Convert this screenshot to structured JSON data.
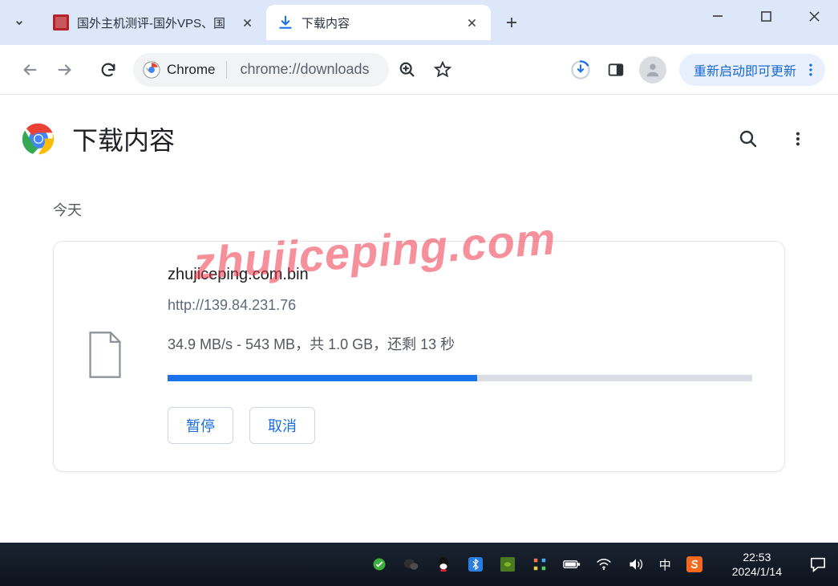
{
  "tabs": [
    {
      "title": "国外主机测评-国外VPS、国"
    },
    {
      "title": "下载内容"
    }
  ],
  "address": {
    "chip": "Chrome",
    "url": "chrome://downloads"
  },
  "update_label": "重新启动即可更新",
  "page_title": "下载内容",
  "section_today": "今天",
  "download": {
    "filename": "zhujiceping.com.bin",
    "url": "http://139.84.231.76",
    "status": "34.9 MB/s - 543 MB，共 1.0 GB，还剩 13 秒",
    "progress_percent": 53,
    "pause": "暂停",
    "cancel": "取消"
  },
  "watermark": "zhujiceping.com",
  "taskbar": {
    "time": "22:53",
    "date": "2024/1/14",
    "ime": "中"
  }
}
